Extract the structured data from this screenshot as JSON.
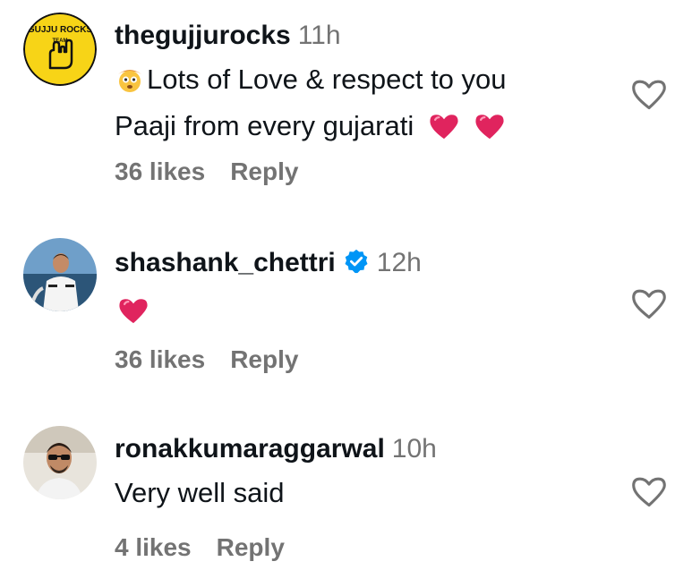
{
  "comments": [
    {
      "username": "thegujjurocks",
      "time": "11h",
      "text_line1": "Lots of Love & respect to you",
      "text_line2": "Paaji from every gujarati",
      "likes": "36 likes",
      "reply": "Reply",
      "avatar_text_top": "GUJJU ROCKS",
      "avatar_text_team": "TEAM"
    },
    {
      "username": "shashank_chettri",
      "time": "12h",
      "verified": true,
      "likes": "36 likes",
      "reply": "Reply"
    },
    {
      "username": "ronakkumaraggarwal",
      "time": "10h",
      "text_line1": "Very well said",
      "likes": "4 likes",
      "reply": "Reply"
    }
  ],
  "icons": {
    "like": "heart-outline-icon",
    "emoji_heart": "red-heart-emoji",
    "emoji_face": "cowboy-face-emoji",
    "verified": "verified-badge-icon"
  },
  "colors": {
    "muted": "#737373",
    "verified": "#0095f6",
    "heart_red": "#e0245e",
    "avatar_yellow": "#f7d417"
  }
}
